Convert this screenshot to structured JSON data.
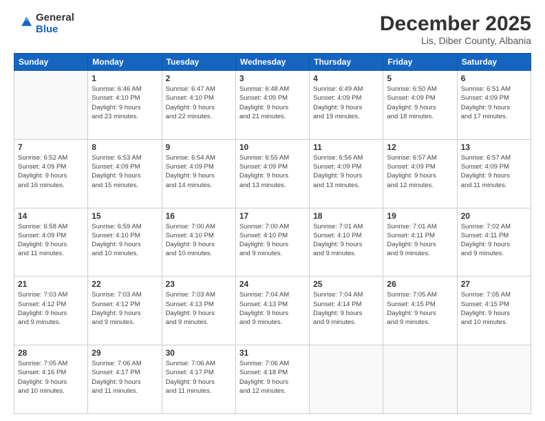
{
  "logo": {
    "general": "General",
    "blue": "Blue"
  },
  "title": "December 2025",
  "location": "Lis, Diber County, Albania",
  "weekdays": [
    "Sunday",
    "Monday",
    "Tuesday",
    "Wednesday",
    "Thursday",
    "Friday",
    "Saturday"
  ],
  "weeks": [
    [
      {
        "day": "",
        "info": ""
      },
      {
        "day": "1",
        "info": "Sunrise: 6:46 AM\nSunset: 4:10 PM\nDaylight: 9 hours\nand 23 minutes."
      },
      {
        "day": "2",
        "info": "Sunrise: 6:47 AM\nSunset: 4:10 PM\nDaylight: 9 hours\nand 22 minutes."
      },
      {
        "day": "3",
        "info": "Sunrise: 6:48 AM\nSunset: 4:09 PM\nDaylight: 9 hours\nand 21 minutes."
      },
      {
        "day": "4",
        "info": "Sunrise: 6:49 AM\nSunset: 4:09 PM\nDaylight: 9 hours\nand 19 minutes."
      },
      {
        "day": "5",
        "info": "Sunrise: 6:50 AM\nSunset: 4:09 PM\nDaylight: 9 hours\nand 18 minutes."
      },
      {
        "day": "6",
        "info": "Sunrise: 6:51 AM\nSunset: 4:09 PM\nDaylight: 9 hours\nand 17 minutes."
      }
    ],
    [
      {
        "day": "7",
        "info": "Sunrise: 6:52 AM\nSunset: 4:09 PM\nDaylight: 9 hours\nand 16 minutes."
      },
      {
        "day": "8",
        "info": "Sunrise: 6:53 AM\nSunset: 4:09 PM\nDaylight: 9 hours\nand 15 minutes."
      },
      {
        "day": "9",
        "info": "Sunrise: 6:54 AM\nSunset: 4:09 PM\nDaylight: 9 hours\nand 14 minutes."
      },
      {
        "day": "10",
        "info": "Sunrise: 6:55 AM\nSunset: 4:09 PM\nDaylight: 9 hours\nand 13 minutes."
      },
      {
        "day": "11",
        "info": "Sunrise: 6:56 AM\nSunset: 4:09 PM\nDaylight: 9 hours\nand 13 minutes."
      },
      {
        "day": "12",
        "info": "Sunrise: 6:57 AM\nSunset: 4:09 PM\nDaylight: 9 hours\nand 12 minutes."
      },
      {
        "day": "13",
        "info": "Sunrise: 6:57 AM\nSunset: 4:09 PM\nDaylight: 9 hours\nand 11 minutes."
      }
    ],
    [
      {
        "day": "14",
        "info": "Sunrise: 6:58 AM\nSunset: 4:09 PM\nDaylight: 9 hours\nand 11 minutes."
      },
      {
        "day": "15",
        "info": "Sunrise: 6:59 AM\nSunset: 4:10 PM\nDaylight: 9 hours\nand 10 minutes."
      },
      {
        "day": "16",
        "info": "Sunrise: 7:00 AM\nSunset: 4:10 PM\nDaylight: 9 hours\nand 10 minutes."
      },
      {
        "day": "17",
        "info": "Sunrise: 7:00 AM\nSunset: 4:10 PM\nDaylight: 9 hours\nand 9 minutes."
      },
      {
        "day": "18",
        "info": "Sunrise: 7:01 AM\nSunset: 4:10 PM\nDaylight: 9 hours\nand 9 minutes."
      },
      {
        "day": "19",
        "info": "Sunrise: 7:01 AM\nSunset: 4:11 PM\nDaylight: 9 hours\nand 9 minutes."
      },
      {
        "day": "20",
        "info": "Sunrise: 7:02 AM\nSunset: 4:11 PM\nDaylight: 9 hours\nand 9 minutes."
      }
    ],
    [
      {
        "day": "21",
        "info": "Sunrise: 7:03 AM\nSunset: 4:12 PM\nDaylight: 9 hours\nand 9 minutes."
      },
      {
        "day": "22",
        "info": "Sunrise: 7:03 AM\nSunset: 4:12 PM\nDaylight: 9 hours\nand 9 minutes."
      },
      {
        "day": "23",
        "info": "Sunrise: 7:03 AM\nSunset: 4:13 PM\nDaylight: 9 hours\nand 9 minutes."
      },
      {
        "day": "24",
        "info": "Sunrise: 7:04 AM\nSunset: 4:13 PM\nDaylight: 9 hours\nand 9 minutes."
      },
      {
        "day": "25",
        "info": "Sunrise: 7:04 AM\nSunset: 4:14 PM\nDaylight: 9 hours\nand 9 minutes."
      },
      {
        "day": "26",
        "info": "Sunrise: 7:05 AM\nSunset: 4:15 PM\nDaylight: 9 hours\nand 9 minutes."
      },
      {
        "day": "27",
        "info": "Sunrise: 7:05 AM\nSunset: 4:15 PM\nDaylight: 9 hours\nand 10 minutes."
      }
    ],
    [
      {
        "day": "28",
        "info": "Sunrise: 7:05 AM\nSunset: 4:16 PM\nDaylight: 9 hours\nand 10 minutes."
      },
      {
        "day": "29",
        "info": "Sunrise: 7:06 AM\nSunset: 4:17 PM\nDaylight: 9 hours\nand 11 minutes."
      },
      {
        "day": "30",
        "info": "Sunrise: 7:06 AM\nSunset: 4:17 PM\nDaylight: 9 hours\nand 11 minutes."
      },
      {
        "day": "31",
        "info": "Sunrise: 7:06 AM\nSunset: 4:18 PM\nDaylight: 9 hours\nand 12 minutes."
      },
      {
        "day": "",
        "info": ""
      },
      {
        "day": "",
        "info": ""
      },
      {
        "day": "",
        "info": ""
      }
    ]
  ]
}
